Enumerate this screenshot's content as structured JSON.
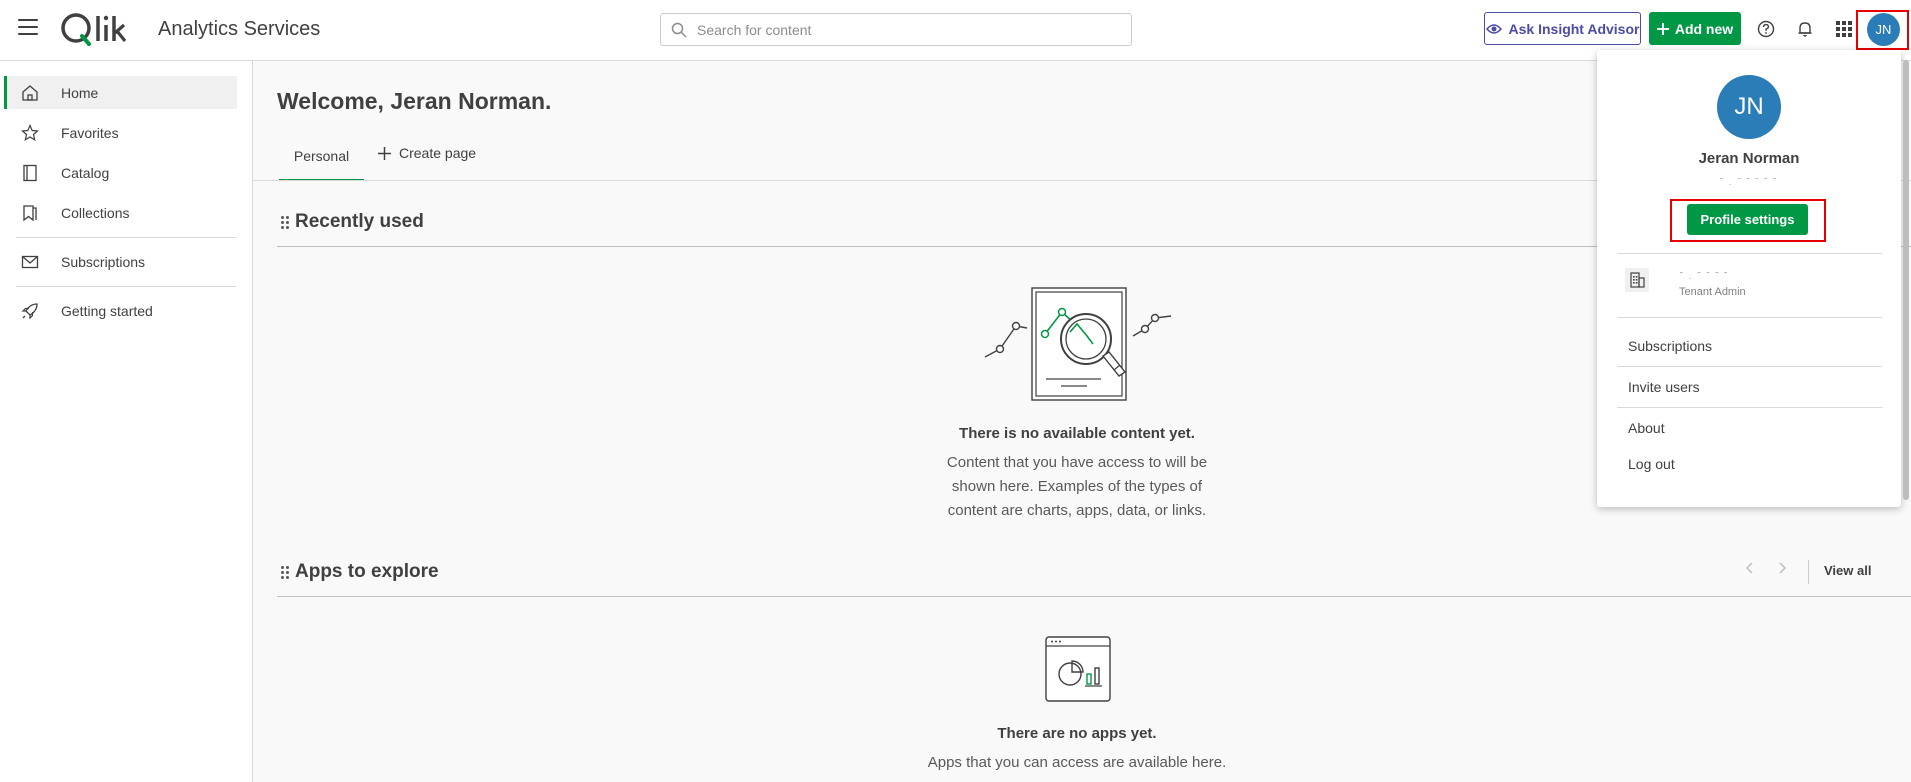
{
  "header": {
    "app_title": "Analytics Services",
    "logo_text": "Qlik",
    "search_placeholder": "Search for content",
    "ask_insight_label": "Ask Insight Advisor",
    "add_new_label": "Add new",
    "avatar_initials": "JN"
  },
  "sidebar": {
    "items": [
      {
        "label": "Home",
        "icon": "home-icon",
        "active": true
      },
      {
        "label": "Favorites",
        "icon": "star-icon"
      },
      {
        "label": "Catalog",
        "icon": "catalog-icon"
      },
      {
        "label": "Collections",
        "icon": "collections-icon"
      },
      {
        "label": "Subscriptions",
        "icon": "envelope-icon"
      },
      {
        "label": "Getting started",
        "icon": "rocket-icon"
      }
    ]
  },
  "main": {
    "welcome": "Welcome, Jeran Norman.",
    "tabs": [
      {
        "label": "Personal"
      },
      {
        "label": "Create page"
      }
    ],
    "recently_used": {
      "title": "Recently used",
      "empty_title": "There is no available content yet.",
      "empty_desc_lines": [
        "Content that you have access to will be",
        "shown here. Examples of the types of",
        "content are charts, apps, data, or links."
      ]
    },
    "apps_to_explore": {
      "title": "Apps to explore",
      "view_all": "View all",
      "empty_title": "There are no apps yet.",
      "empty_desc_line1": "Apps that you can access are available here."
    }
  },
  "profile_menu": {
    "initials": "JN",
    "name": "Jeran Norman",
    "profile_settings_label": "Profile settings",
    "tenant_role": "Tenant Admin",
    "items": [
      "Subscriptions",
      "Invite users",
      "About",
      "Log out"
    ]
  },
  "colors": {
    "brand_green": "#009845",
    "insight_purple": "#4c4ba5",
    "avatar_blue": "#2b7db7",
    "highlight_red": "#e60000"
  }
}
